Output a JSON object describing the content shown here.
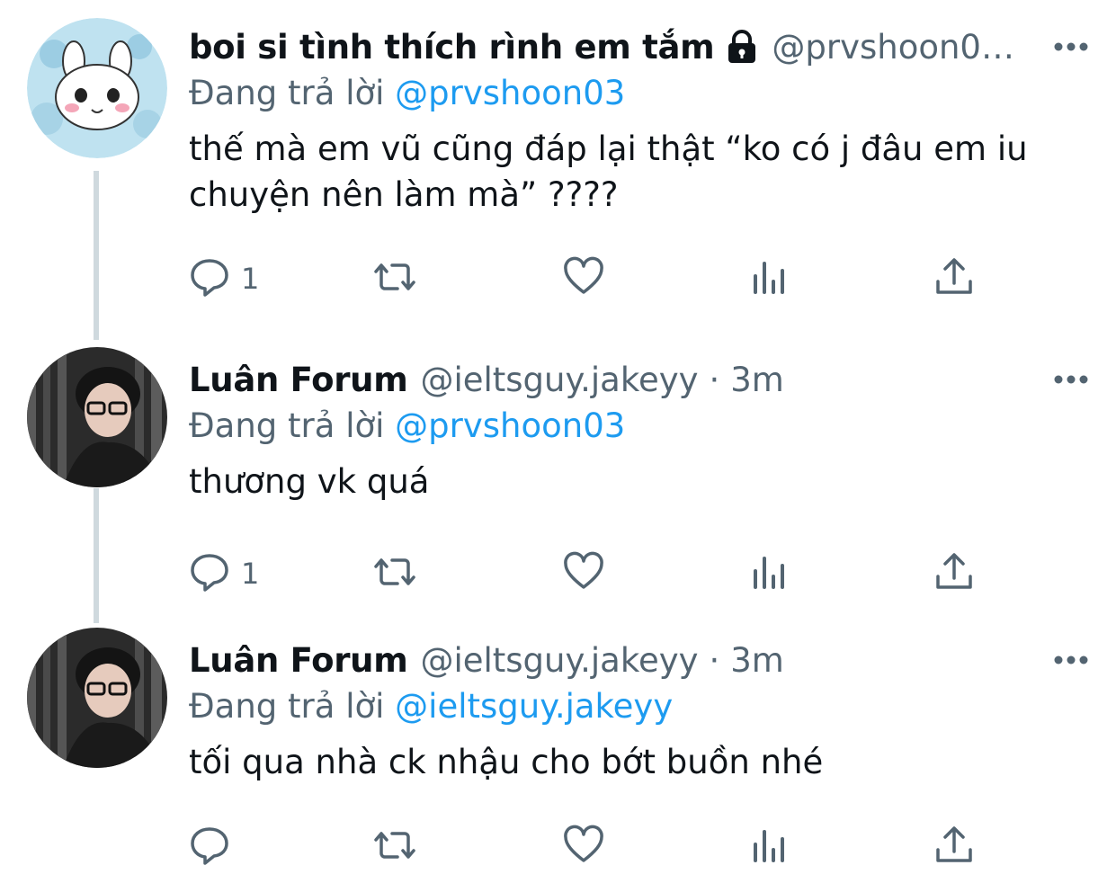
{
  "tweets": [
    {
      "name": "boi si tình thích rình em tắm",
      "handle": "@prvshoon0…",
      "time": "",
      "protected": true,
      "replying_label": "Đang trả lời",
      "replying_to": "@prvshoon03",
      "text": "thế mà em vũ cũng đáp lại thật “ko có j đâu em iu chuyện nên làm mà” ????",
      "reply_count": "1"
    },
    {
      "name": "Luân Forum",
      "handle": "@ieltsguy.jakeyy",
      "separator": "·",
      "time": "3m",
      "replying_label": "Đang trả lời",
      "replying_to": "@prvshoon03",
      "text": "thương vk quá",
      "reply_count": "1"
    },
    {
      "name": "Luân Forum",
      "handle": "@ieltsguy.jakeyy",
      "separator": "·",
      "time": "3m",
      "replying_label": "Đang trả lời",
      "replying_to": "@ieltsguy.jakeyy",
      "text": "tối qua nhà ck nhậu cho bớt buồn nhé",
      "reply_count": ""
    }
  ],
  "icons": {
    "reply": "reply-icon",
    "retweet": "retweet-icon",
    "like": "heart-icon",
    "views": "analytics-icon",
    "share": "share-icon",
    "more": "more-icon",
    "lock": "lock-icon"
  },
  "colors": {
    "accent": "#1d9bf0",
    "muted": "#536471",
    "thread_line": "#cfd9de"
  }
}
